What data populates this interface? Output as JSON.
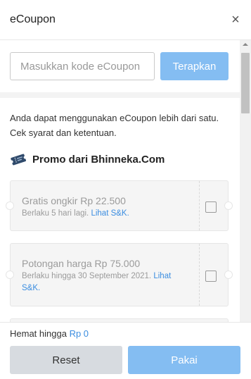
{
  "header": {
    "title": "eCoupon",
    "close_symbol": "×"
  },
  "code_entry": {
    "placeholder": "Masukkan kode eCoupon",
    "value": "",
    "apply_label": "Terapkan"
  },
  "info_text": "Anda dapat menggunakan eCoupon lebih dari satu. Cek syarat dan ketentuan.",
  "promo_section": {
    "icon": "ticket-icon",
    "title": "Promo dari Bhinneka.Com",
    "coupons": [
      {
        "title": "Gratis ongkir Rp 22.500",
        "validity": "Berlaku 5 hari lagi.",
        "tnc": "Lihat S&K.",
        "checked": false
      },
      {
        "title": "Potongan harga Rp 75.000",
        "validity_line1": "Berlaku hingga 30 September 2021.",
        "tnc_line1": "Lihat",
        "tnc_line2": "S&K.",
        "checked": false
      }
    ]
  },
  "footer": {
    "save_label": "Hemat hingga",
    "save_amount": "Rp 0",
    "reset_label": "Reset",
    "use_label": "Pakai"
  },
  "colors": {
    "primary_disabled": "#84bdf2",
    "link": "#3b8de0",
    "reset_bg": "#d7dbe0"
  }
}
